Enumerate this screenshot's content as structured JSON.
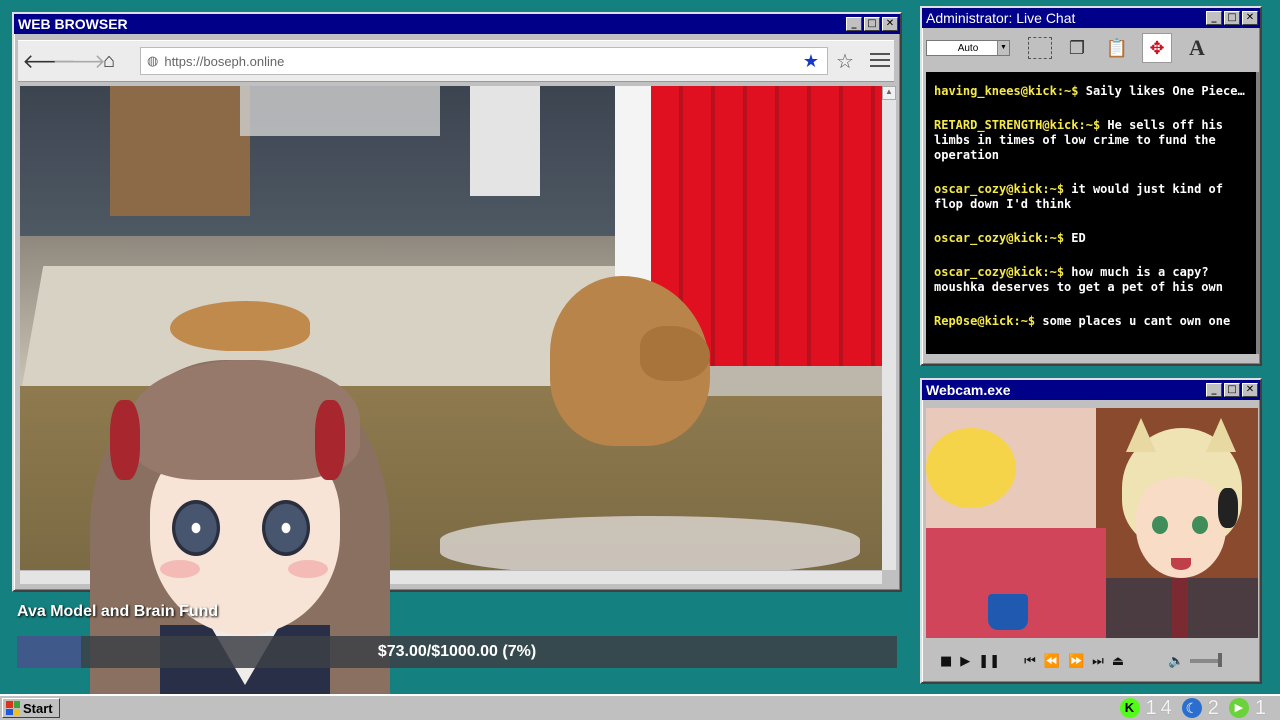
{
  "browser": {
    "title": "WEB BROWSER",
    "url": "https://boseph.online",
    "icons": [
      "back-arrow-icon",
      "forward-arrow-icon",
      "home-icon",
      "globe-icon",
      "bookmark-star-filled-icon",
      "star-outline-icon",
      "hamburger-menu-icon"
    ]
  },
  "fund": {
    "title": "Ava Model and Brain Fund",
    "progress_text": "$73.00/$1000.00 (7%)",
    "progress_fraction": 0.073,
    "fill_color": "#3f5a8a"
  },
  "chat": {
    "title": "Administrator: Live Chat",
    "select_value": "Auto",
    "messages": [
      {
        "user": "having_knees@kick:~$",
        "text": "Saily likes One Piece…"
      },
      {
        "user": "RETARD_STRENGTH@kick:~$",
        "text": "He sells off his limbs in times of low crime to fund the operation"
      },
      {
        "user": "oscar_cozy@kick:~$",
        "text": "it would just kind of flop down I'd think"
      },
      {
        "user": "oscar_cozy@kick:~$",
        "text": "ED"
      },
      {
        "user": "oscar_cozy@kick:~$",
        "text": "how much is a capy? moushka deserves to get a pet of his own"
      },
      {
        "user": "Rep0se@kick:~$",
        "text": "some places u cant own one"
      }
    ],
    "username_color": "#f5e84a"
  },
  "webcam": {
    "title": "Webcam.exe"
  },
  "taskbar": {
    "start_label": "Start",
    "kick_count": "14",
    "moon_count": "2",
    "play_count": "1"
  },
  "window_buttons": {
    "minimize": "_",
    "maximize": "□",
    "close": "✕"
  },
  "colors": {
    "desktop": "#14807f",
    "titlebar": "#000088",
    "red_wall": "#e01020"
  }
}
